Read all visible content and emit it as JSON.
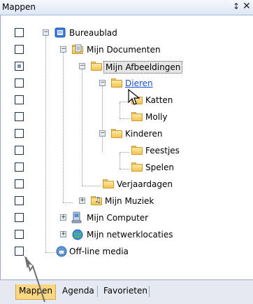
{
  "panel": {
    "title": "Mappen",
    "pin_icon": "pin-icon",
    "close_icon": "close-icon"
  },
  "tree": [
    {
      "label": "Bureaublad",
      "icon": "desktop-icon",
      "expanded": true,
      "check": "empty"
    },
    {
      "label": "Mijn Documenten",
      "icon": "documents-folder-icon",
      "expanded": true,
      "check": "empty"
    },
    {
      "label": "Mijn Afbeeldingen",
      "icon": "folder-open-icon",
      "expanded": true,
      "selected": true,
      "check": "partial"
    },
    {
      "label": "Dieren",
      "icon": "folder-open-icon",
      "expanded": true,
      "hot": true,
      "check": "empty"
    },
    {
      "label": "Katten",
      "icon": "folder-icon",
      "check": "empty"
    },
    {
      "label": "Molly",
      "icon": "folder-icon",
      "check": "empty"
    },
    {
      "label": "Kinderen",
      "icon": "folder-open-icon",
      "expanded": true,
      "check": "empty"
    },
    {
      "label": "Feestjes",
      "icon": "folder-icon",
      "check": "empty"
    },
    {
      "label": "Spelen",
      "icon": "folder-icon",
      "check": "empty"
    },
    {
      "label": "Verjaardagen",
      "icon": "folder-icon",
      "check": "empty"
    },
    {
      "label": "Mijn Muziek",
      "icon": "music-folder-icon",
      "expanded": false,
      "check": "empty"
    },
    {
      "label": "Mijn Computer",
      "icon": "computer-icon",
      "expanded": false,
      "check": "empty"
    },
    {
      "label": "Mijn netwerklocaties",
      "icon": "network-icon",
      "expanded": false,
      "check": "empty"
    },
    {
      "label": "Off-line media",
      "icon": "offline-media-icon",
      "check": "empty"
    }
  ],
  "tabs": [
    {
      "label": "Mappen",
      "active": true
    },
    {
      "label": "Agenda",
      "active": false
    },
    {
      "label": "Favorieten",
      "active": false
    }
  ],
  "colors": {
    "titlebar": "#dde6f4",
    "selected_background": "#e6e6e6",
    "hot_link": "#1a52d1",
    "active_tab": "#fbd783",
    "folder": "#f5c54f"
  }
}
